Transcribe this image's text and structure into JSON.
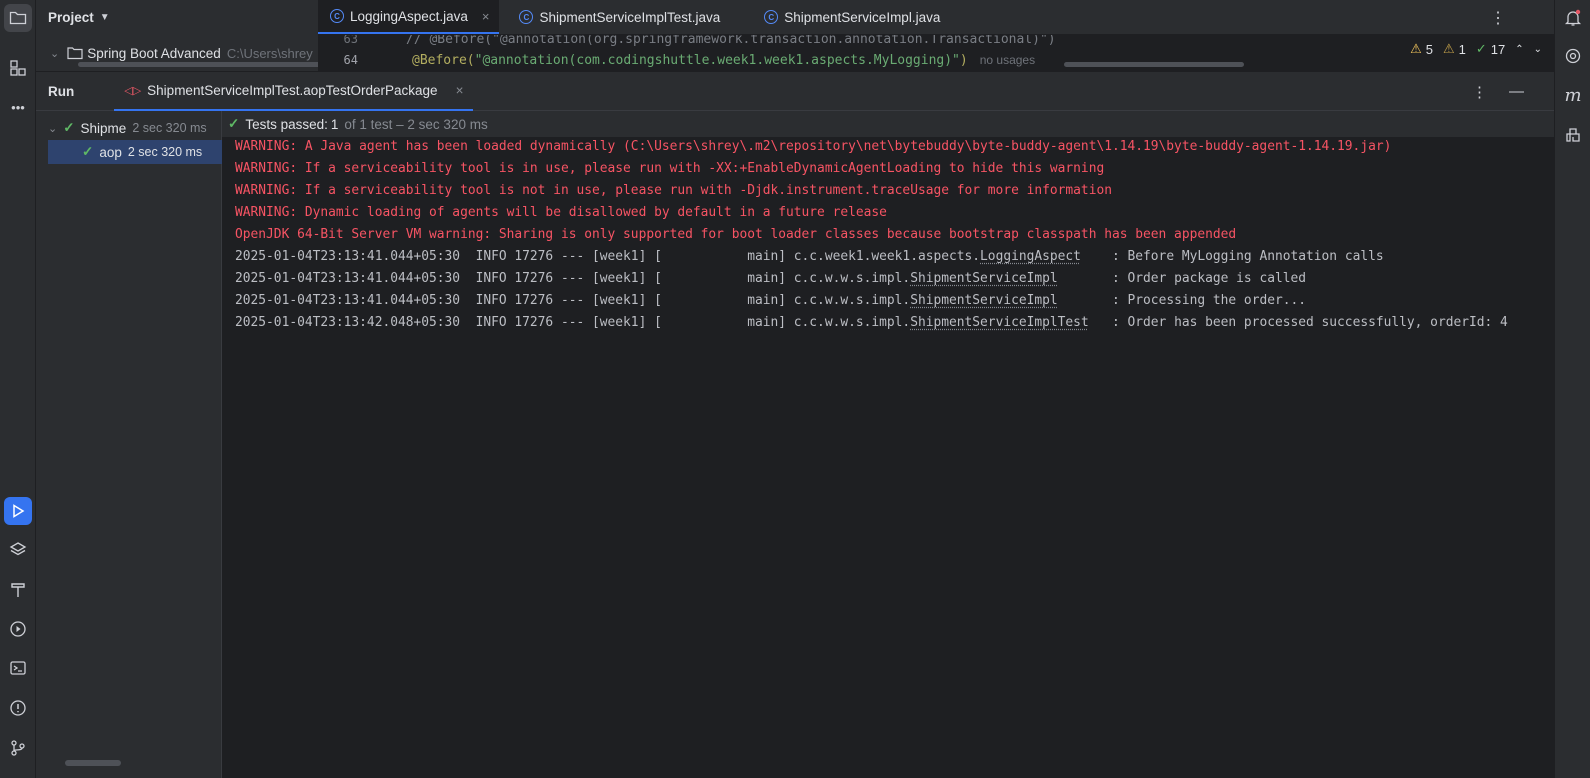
{
  "project": {
    "title": "Project",
    "root_name": "Spring Boot Advanced",
    "root_path": "C:\\Users\\shrey"
  },
  "tabs": [
    {
      "label": "LoggingAspect.java",
      "close": "×"
    },
    {
      "label": "ShipmentServiceImplTest.java"
    },
    {
      "label": "ShipmentServiceImpl.java"
    }
  ],
  "editor": {
    "line63_num": "63",
    "line63_text": "// @Before(\"@annotation(org.springframework.transaction.annotation.Transactional)\")",
    "line64_num": "64",
    "line64_annotation": "@Before(",
    "line64_string": "\"@annotation(com.codingshuttle.week1.week1.aspects.MyLogging)\"",
    "line64_close": ")",
    "line64_hint": "no usages"
  },
  "inspections": {
    "warnings": "5",
    "weak_warnings": "1",
    "ok": "17"
  },
  "run": {
    "title": "Run",
    "config_tab": "ShipmentServiceImplTest.aopTestOrderPackage",
    "close": "×"
  },
  "tree": {
    "root_label": "Shipme",
    "root_duration": "2 sec 320 ms",
    "child_label": "aop",
    "child_duration": "2 sec 320 ms"
  },
  "status": {
    "label": "Tests passed:",
    "count": "1",
    "detail": "of 1 test – 2 sec 320 ms"
  },
  "console": {
    "errors": [
      "WARNING: A Java agent has been loaded dynamically (C:\\Users\\shrey\\.m2\\repository\\net\\bytebuddy\\byte-buddy-agent\\1.14.19\\byte-buddy-agent-1.14.19.jar)",
      "WARNING: If a serviceability tool is in use, please run with -XX:+EnableDynamicAgentLoading to hide this warning",
      "WARNING: If a serviceability tool is not in use, please run with -Djdk.instrument.traceUsage for more information",
      "WARNING: Dynamic loading of agents will be disallowed by default in a future release",
      "OpenJDK 64-Bit Server VM warning: Sharing is only supported for boot loader classes because bootstrap classpath has been appended"
    ],
    "info": [
      {
        "prefix": "2025-01-04T23:13:41.044+05:30  INFO 17276 --- [week1] [           main] c.c.week1.week1.aspects.",
        "cls": "LoggingAspect",
        "suffix": "    : Before MyLogging Annotation calls"
      },
      {
        "prefix": "2025-01-04T23:13:41.044+05:30  INFO 17276 --- [week1] [           main] c.c.w.w.s.impl.",
        "cls": "ShipmentServiceImpl",
        "suffix": "       : Order package is called"
      },
      {
        "prefix": "2025-01-04T23:13:41.044+05:30  INFO 17276 --- [week1] [           main] c.c.w.w.s.impl.",
        "cls": "ShipmentServiceImpl",
        "suffix": "       : Processing the order..."
      },
      {
        "prefix": "2025-01-04T23:13:42.048+05:30  INFO 17276 --- [week1] [           main] c.c.w.w.s.impl.",
        "cls": "ShipmentServiceImplTest",
        "suffix": "   : Order has been processed successfully, orderId: 4"
      }
    ]
  }
}
